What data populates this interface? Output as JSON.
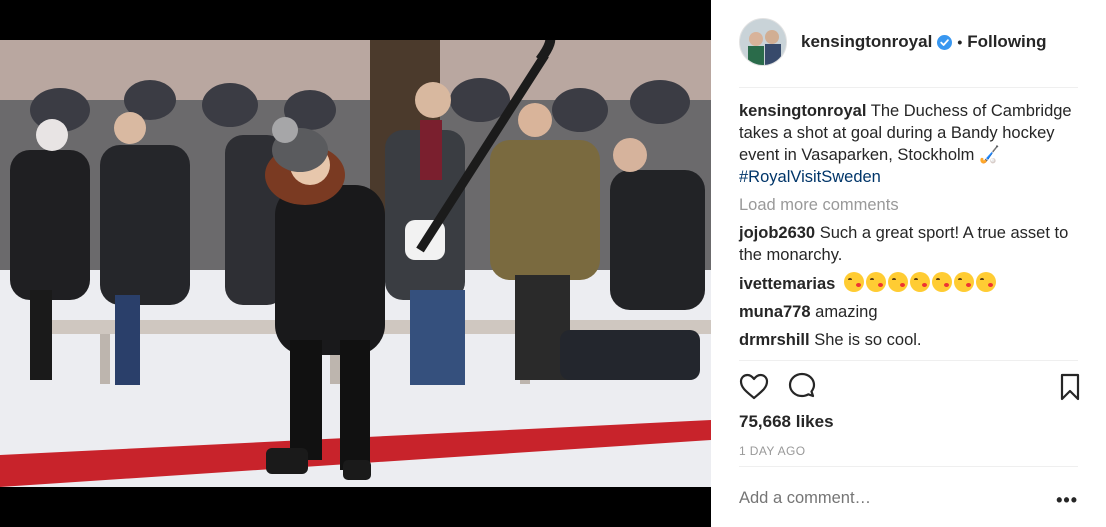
{
  "post": {
    "username": "kensingtonroyal",
    "follow_status": "Following",
    "separator": "•"
  },
  "caption": {
    "username": "kensingtonroyal",
    "text": "The Duchess of Cambridge takes a shot at goal during a Bandy hockey event in Vasaparken, Stockholm",
    "emoji": "🏑",
    "hashtag": "#RoyalVisitSweden"
  },
  "load_more_label": "Load more comments",
  "comments": [
    {
      "username": "jojob2630",
      "text": "Such a great sport! A true asset to the monarchy."
    },
    {
      "username": "ivettemarias",
      "text": "",
      "emoji_name": "face-blowing-kiss",
      "emoji_count": 7
    },
    {
      "username": "muna778",
      "text": "amazing"
    },
    {
      "username": "drmrshill",
      "text": "She is so cool."
    }
  ],
  "likes_text": "75,668 likes",
  "timestamp": "1 DAY AGO",
  "add_comment_placeholder": "Add a comment…",
  "more_label": "•••",
  "icons": {
    "like": "heart-icon",
    "comment": "speech-bubble-icon",
    "save": "bookmark-icon",
    "verified": "verified-badge-icon",
    "more": "more-options-icon"
  },
  "colors": {
    "verified": "#3897f0",
    "hashtag": "#003569",
    "muted": "#999999",
    "text": "#262626"
  }
}
